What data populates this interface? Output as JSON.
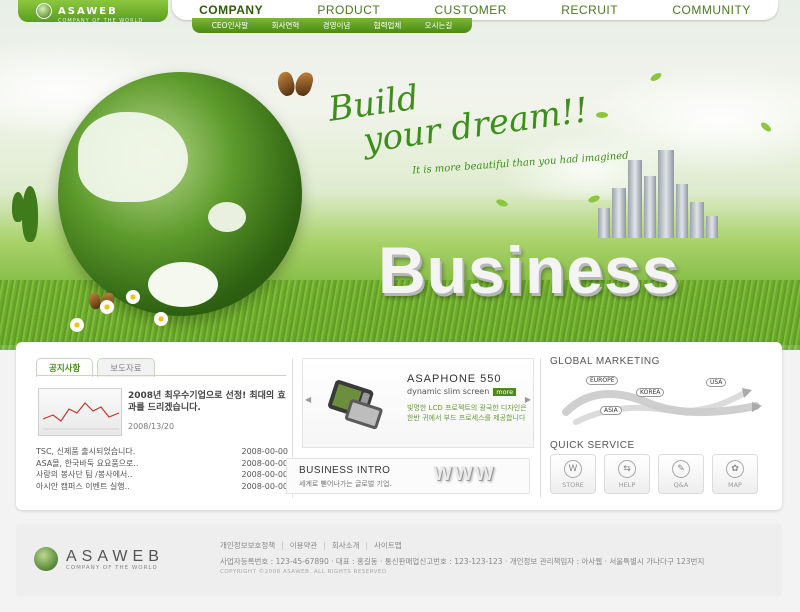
{
  "header": {
    "brand": "ASAWEB",
    "brand_tagline": "COMPANY OF THE WORLD",
    "nav": [
      "COMPANY",
      "PRODUCT",
      "CUSTOMER",
      "RECRUIT",
      "COMMUNITY"
    ],
    "sub_nav": [
      "CEO인사말",
      "회사연혁",
      "경영이념",
      "협력업체",
      "오시는길"
    ]
  },
  "hero": {
    "heading_line1": "Build",
    "heading_line2": "your dream!!",
    "tagline": "It is more beautiful than you had imagined",
    "big_word": "Business"
  },
  "notice": {
    "tabs": [
      "공지사항",
      "보도자료"
    ],
    "featured_title": "2008년 최우수기업으로 선정! 최대의 효과를 드리겠습니다.",
    "featured_date": "2008/13/20",
    "items": [
      {
        "text": "TSC, 신제품 출시되었습니다.",
        "date": "2008-00-00"
      },
      {
        "text": "ASA몰, 한국바둑 요요품으로..",
        "date": "2008-00-00"
      },
      {
        "text": "사랑의 봉사단 팀 /봉사에서..",
        "date": "2008-00-00"
      },
      {
        "text": "아시안 캠퍼스 이벤트 실행..",
        "date": "2008-00-00"
      }
    ]
  },
  "product": {
    "name": "ASAPHONE 550",
    "subtitle": "dynamic slim screen",
    "badge": "more",
    "description": "빛명한 LCD 프로젝트의 광국한 디자인은 한반 귀에서 부드 프로세스를 제공합니다"
  },
  "business_intro": {
    "title": "BUSINESS INTRO",
    "subtitle": "세계로 뻗어나가는 글로벌 기업.",
    "graphic_text": "WWW"
  },
  "global_marketing": {
    "title": "GLOBAL MARKETING",
    "regions": [
      "EUROPE",
      "KOREA",
      "USA",
      "ASIA"
    ]
  },
  "quick_service": {
    "title": "QUICK SERVICE",
    "items": [
      {
        "label": "STORE",
        "icon": "store-icon",
        "glyph": "W"
      },
      {
        "label": "HELP",
        "icon": "help-icon",
        "glyph": "⇆"
      },
      {
        "label": "Q&A",
        "icon": "qna-icon",
        "glyph": "✎"
      },
      {
        "label": "MAP",
        "icon": "map-icon",
        "glyph": "✿"
      }
    ]
  },
  "footer": {
    "brand": "ASAWEB",
    "brand_tagline": "COMPANY OF THE WORLD",
    "links": [
      "개인정보보호정책",
      "이용약관",
      "회사소개",
      "사이트맵"
    ],
    "info": "사업자등록번호 : 123-45-67890 · 대표 : 홍길동 · 통신판매업신고번호 : 123-123-123 · 개인정보 관리책임자 : 아사웹 · 서울특별시 가나다구 123번지",
    "copyright": "COPYRIGHT ©2008 ASAWEB. ALL RIGHTS RESERVED"
  },
  "colors": {
    "brand_green": "#5a9d1e",
    "nav_text": "#4a7a20",
    "accent_text": "#3d8f1c"
  }
}
